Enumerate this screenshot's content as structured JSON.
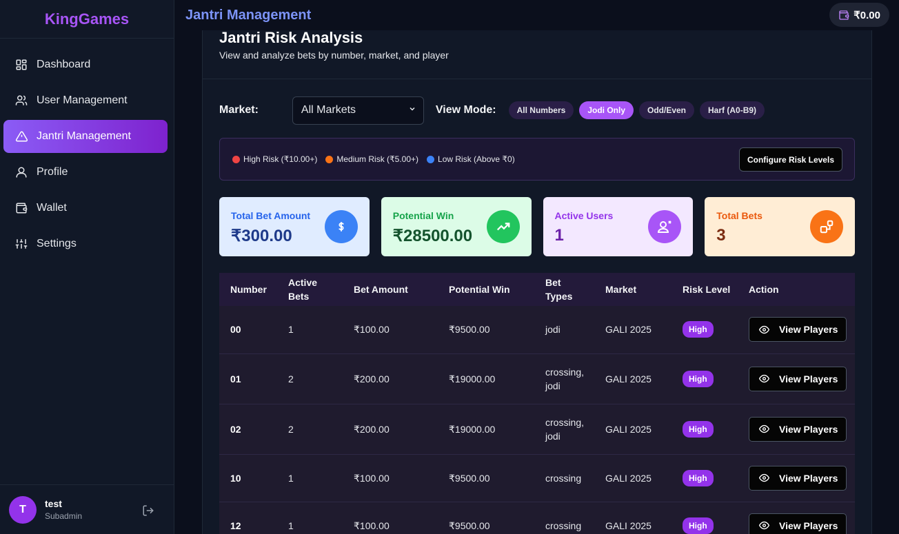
{
  "app": {
    "brand": "KingGames",
    "page_title": "Jantri Management",
    "wallet_balance": "₹0.00"
  },
  "sidebar": {
    "items": [
      {
        "label": "Dashboard",
        "icon": "dashboard-icon"
      },
      {
        "label": "User Management",
        "icon": "users-icon"
      },
      {
        "label": "Jantri Management",
        "icon": "alert-triangle-icon",
        "active": true
      },
      {
        "label": "Profile",
        "icon": "user-icon"
      },
      {
        "label": "Wallet",
        "icon": "wallet-icon"
      },
      {
        "label": "Settings",
        "icon": "sliders-icon"
      }
    ],
    "user": {
      "initial": "T",
      "name": "test",
      "role": "Subadmin"
    }
  },
  "main": {
    "title": "Jantri Risk Analysis",
    "subtitle": "View and analyze bets by number, market, and player",
    "filters": {
      "market_label": "Market:",
      "market_value": "All Markets",
      "view_mode_label": "View Mode:",
      "view_modes": [
        "All Numbers",
        "Jodi Only",
        "Odd/Even",
        "Harf (A0-B9)"
      ],
      "active_view_mode": "Jodi Only"
    },
    "legend": {
      "items": [
        {
          "label": "High Risk (₹10.00+)",
          "color": "#ef4444"
        },
        {
          "label": "Medium Risk (₹5.00+)",
          "color": "#f97316"
        },
        {
          "label": "Low Risk (Above ₹0)",
          "color": "#3b82f6"
        }
      ],
      "configure_label": "Configure Risk Levels"
    },
    "stats": [
      {
        "label": "Total Bet Amount",
        "value": "₹300.00",
        "icon": "dollar-icon",
        "bg": "#e0ecff",
        "label_color": "#2563eb",
        "value_color": "#1e3a8a",
        "icon_bg": "#3b82f6"
      },
      {
        "label": "Potential Win",
        "value": "₹28500.00",
        "icon": "trending-up-icon",
        "bg": "#dcfce7",
        "label_color": "#16a34a",
        "value_color": "#14532d",
        "icon_bg": "#22c55e"
      },
      {
        "label": "Active Users",
        "value": "1",
        "icon": "user-check-icon",
        "bg": "#f3e8ff",
        "label_color": "#9333ea",
        "value_color": "#6b21a8",
        "icon_bg": "#a855f7"
      },
      {
        "label": "Total Bets",
        "value": "3",
        "icon": "shapes-icon",
        "bg": "#ffedd5",
        "label_color": "#ea580c",
        "value_color": "#7c2d12",
        "icon_bg": "#f97316"
      }
    ],
    "table": {
      "headers": [
        "Number",
        "Active Bets",
        "Bet Amount",
        "Potential Win",
        "Bet Types",
        "Market",
        "Risk Level",
        "Action"
      ],
      "rows": [
        {
          "number": "00",
          "active_bets": "1",
          "bet_amount": "₹100.00",
          "potential_win": "₹9500.00",
          "bet_types": "jodi",
          "market": "GALI 2025",
          "risk": "High",
          "action": "View Players"
        },
        {
          "number": "01",
          "active_bets": "2",
          "bet_amount": "₹200.00",
          "potential_win": "₹19000.00",
          "bet_types": "crossing, jodi",
          "market": "GALI 2025",
          "risk": "High",
          "action": "View Players"
        },
        {
          "number": "02",
          "active_bets": "2",
          "bet_amount": "₹200.00",
          "potential_win": "₹19000.00",
          "bet_types": "crossing, jodi",
          "market": "GALI 2025",
          "risk": "High",
          "action": "View Players"
        },
        {
          "number": "10",
          "active_bets": "1",
          "bet_amount": "₹100.00",
          "potential_win": "₹9500.00",
          "bet_types": "crossing",
          "market": "GALI 2025",
          "risk": "High",
          "action": "View Players"
        },
        {
          "number": "12",
          "active_bets": "1",
          "bet_amount": "₹100.00",
          "potential_win": "₹9500.00",
          "bet_types": "crossing",
          "market": "GALI 2025",
          "risk": "High",
          "action": "View Players"
        }
      ]
    }
  }
}
